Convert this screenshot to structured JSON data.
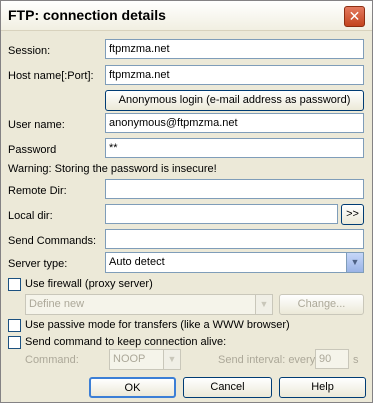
{
  "window": {
    "title": "FTP: connection details",
    "close_glyph": "✕"
  },
  "fields": {
    "session": {
      "label": "Session:",
      "value": "ftpmzma.net"
    },
    "host": {
      "label": "Host name[:Port]:",
      "value": "ftpmzma.net"
    },
    "anonymous_button": "Anonymous login (e-mail address as password)",
    "username": {
      "label": "User name:",
      "value": "anonymous@ftpmzma.net"
    },
    "password": {
      "label": "Password",
      "value": "**"
    },
    "warning": "Warning: Storing the password is insecure!",
    "remote_dir": {
      "label": "Remote Dir:",
      "value": ""
    },
    "local_dir": {
      "label": "Local dir:",
      "value": "",
      "browse": ">>"
    },
    "send_commands": {
      "label": "Send Commands:",
      "value": ""
    },
    "server_type": {
      "label": "Server type:",
      "value": "Auto detect"
    }
  },
  "firewall": {
    "checkbox_label": "Use firewall (proxy server)",
    "select_value": "Define new",
    "change_button": "Change..."
  },
  "passive": {
    "checkbox_label": "Use passive mode for transfers (like a WWW browser)"
  },
  "keepalive": {
    "checkbox_label": "Send command to keep connection alive:",
    "command_label": "Command:",
    "command_value": "NOOP",
    "interval_label": "Send interval: every",
    "interval_value": "90",
    "interval_unit": "s"
  },
  "buttons": {
    "ok": "OK",
    "cancel": "Cancel",
    "help": "Help"
  },
  "icons": {
    "dropdown": "▼"
  }
}
